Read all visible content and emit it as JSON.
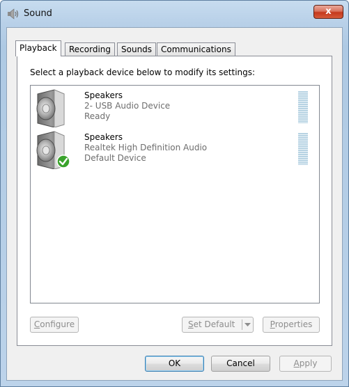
{
  "window": {
    "title": "Sound",
    "close_label": "x"
  },
  "tabs": [
    {
      "label": "Playback",
      "active": true
    },
    {
      "label": "Recording",
      "active": false
    },
    {
      "label": "Sounds",
      "active": false
    },
    {
      "label": "Communications",
      "active": false
    }
  ],
  "instruction": "Select a playback device below to modify its settings:",
  "devices": [
    {
      "name": "Speakers",
      "description": "2- USB Audio Device",
      "status": "Ready",
      "is_default": false
    },
    {
      "name": "Speakers",
      "description": "Realtek High Definition Audio",
      "status": "Default Device",
      "is_default": true
    }
  ],
  "panel_buttons": {
    "configure": {
      "label_accel": "C",
      "label_rest": "onfigure",
      "enabled": false
    },
    "set_default": {
      "label_accel": "S",
      "label_rest": "et Default",
      "enabled": false
    },
    "properties": {
      "label_accel": "P",
      "label_rest": "roperties",
      "enabled": false
    }
  },
  "dialog_buttons": {
    "ok": {
      "label": "OK"
    },
    "cancel": {
      "label": "Cancel"
    },
    "apply": {
      "label_accel": "A",
      "label_rest": "pply",
      "enabled": false
    }
  },
  "icons": {
    "window_icon": "speaker-icon",
    "device_icon": "speaker-icon",
    "default_badge": "checkmark-icon",
    "split_arrow": "chevron-down-icon"
  },
  "colors": {
    "default_badge": "#3aa32c",
    "level_meter": "#b7d3e3",
    "close_button": "#c4381c"
  }
}
